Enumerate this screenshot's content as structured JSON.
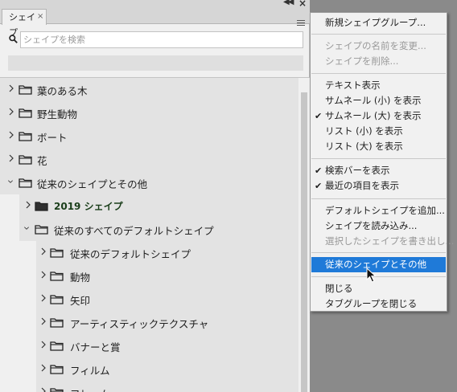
{
  "panel": {
    "tab_label": "シェイプ",
    "search_placeholder": "シェイプを検索"
  },
  "tree": [
    {
      "label": "葉のある木",
      "expanded": false,
      "level": 0
    },
    {
      "label": "野生動物",
      "expanded": false,
      "level": 0
    },
    {
      "label": "ボート",
      "expanded": false,
      "level": 0
    },
    {
      "label": "花",
      "expanded": false,
      "level": 0
    },
    {
      "label": "従来のシェイプとその他",
      "expanded": true,
      "level": 0
    },
    {
      "label": "2019 シェイプ",
      "expanded": false,
      "level": 1
    },
    {
      "label": "従来のすべてのデフォルトシェイプ",
      "expanded": true,
      "level": 1
    },
    {
      "label": "従来のデフォルトシェイプ",
      "expanded": false,
      "level": 2
    },
    {
      "label": "動物",
      "expanded": false,
      "level": 2
    },
    {
      "label": "矢印",
      "expanded": false,
      "level": 2
    },
    {
      "label": "アーティスティックテクスチャ",
      "expanded": false,
      "level": 2
    },
    {
      "label": "バナーと賞",
      "expanded": false,
      "level": 2
    },
    {
      "label": "フィルム",
      "expanded": false,
      "level": 2
    },
    {
      "label": "フレーム",
      "expanded": false,
      "level": 2
    }
  ],
  "menu": {
    "new_group": "新規シェイプグループ...",
    "rename": "シェイプの名前を変更...",
    "delete": "シェイプを削除...",
    "text_view": "テキスト表示",
    "small_thumb": "サムネール (小) を表示",
    "large_thumb": "サムネール (大) を表示",
    "small_list": "リスト (小) を表示",
    "large_list": "リスト (大) を表示",
    "show_search": "検索バーを表示",
    "show_recent": "最近の項目を表示",
    "add_default": "デフォルトシェイプを追加...",
    "load": "シェイプを読み込み...",
    "export_selected": "選択したシェイプを書き出し...",
    "legacy": "従来のシェイプとその他",
    "close": "閉じる",
    "close_tab_group": "タブグループを閉じる"
  }
}
